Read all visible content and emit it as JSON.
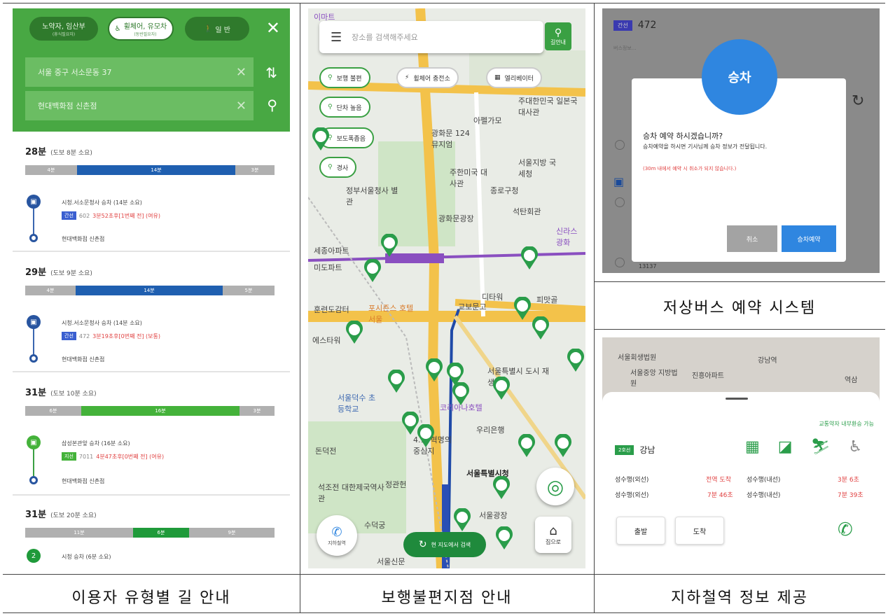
{
  "captions": [
    "이용자 유형별 길 안내",
    "보행불편지점 안내",
    "저상버스 예약 시스템",
    "지하철역 정보 제공"
  ],
  "panel1": {
    "user_types": [
      {
        "label": "노약자, 임산부",
        "sub": "(휴식필요자)"
      },
      {
        "label": "휠체어, 유모차",
        "sub": "(동반필요자)"
      },
      {
        "label": "일 반"
      }
    ],
    "close": "✕",
    "origin": "서울 중구 서소문동 37",
    "destination": "현대백화점 신촌점",
    "routes": [
      {
        "time": "28분",
        "walk": "(도보 8분 소요)",
        "segments": [
          "4분",
          "14분",
          "3분"
        ],
        "board": "시청.서소문청사 승차 (14분 소요)",
        "line_tag": "간선",
        "line_no": "602",
        "arrival": "3분52초후[1번째 전] (여유)",
        "dest": "현대백화점 신촌점"
      },
      {
        "time": "29분",
        "walk": "(도보 9분 소요)",
        "segments": [
          "4분",
          "14분",
          "5분"
        ],
        "board": "시청.서소문청사 승차 (14분 소요)",
        "line_tag": "간선",
        "line_no": "472",
        "arrival": "3분19초후[0번째 전] (보통)",
        "dest": "현대백화점 신촌점"
      },
      {
        "time": "31분",
        "walk": "(도보 10분 소요)",
        "segments": [
          "6분",
          "16분",
          "3분"
        ],
        "board": "삼성본관앞 승차 (16분 소요)",
        "line_tag": "지선",
        "line_no": "7011",
        "arrival": "4분47초후[0번째 전] (여유)",
        "dest": "현대백화점 신촌점"
      },
      {
        "time": "31분",
        "walk": "(도보 20분 소요)",
        "segments": [
          "11분",
          "6분",
          "9분"
        ],
        "board": "시청 승차 (6분 소요)",
        "line_no": "2"
      }
    ]
  },
  "panel2": {
    "search_placeholder": "장소를 검색해주세요",
    "loc_label": "길안내",
    "filters": [
      "보행 불편",
      "휠체어 충전소",
      "엘리베이터",
      "단차 높음",
      "보도폭좁음",
      "경사"
    ],
    "map_labels": [
      "주한미국 대사관",
      "종로구청",
      "정부서울청사 별관",
      "광화문광장",
      "세종아파트",
      "미도파트",
      "서울지방 국세청",
      "석탄회관",
      "아펠가모",
      "교보문고",
      "디타워",
      "피맛골",
      "훈련도감터",
      "포시즌스 호텔 서울",
      "에스타워",
      "서울특별시 도시 재생본부",
      "서울덕수 초등학교",
      "코리아나호텔",
      "우리은행",
      "4.19혁명의 중심지",
      "돈덕전",
      "석조전 대한제국역사관",
      "정관헌",
      "서울특별시청",
      "서울광장",
      "수덕궁",
      "주대한민국 일본국대사관",
      "광화문 124뮤지엄",
      "신라스 광화",
      "이마트",
      "서울신문"
    ],
    "subway_btn": "지하철역",
    "search_map": "현 지도에서 검색",
    "home_btn": "집으로"
  },
  "panel3": {
    "bus_tag": "간선",
    "bus_no": "472",
    "stop_info": "버스정보...",
    "modal_title": "승차",
    "question": "승차 예약 하시겠습니까?",
    "desc": "승차예약을 하시면 기사님께 승차 정보가 전달됩니다.",
    "warning": "(30m 내에서 예약 시 취소가 되지 않습니다.)",
    "cancel": "취소",
    "confirm": "승차예약",
    "stop_no": "13137"
  },
  "panel4": {
    "map_labels": [
      "서울회생법원",
      "강남역",
      "서울중앙 지방법원",
      "진흥아파트",
      "역삼"
    ],
    "transfer": "교통약자 내부환승 가능",
    "line_tag": "2호선",
    "station": "강남",
    "rows": [
      [
        "성수행(외선)",
        "전역 도착",
        "성수행(내선)",
        "3분 6초"
      ],
      [
        "성수행(외선)",
        "7분 46초",
        "성수행(내선)",
        "7분 39초"
      ]
    ],
    "depart": "출발",
    "arrive": "도착"
  },
  "colors": {
    "green": "#48a843",
    "blue": "#2f86e0",
    "navy": "#2855a0"
  }
}
